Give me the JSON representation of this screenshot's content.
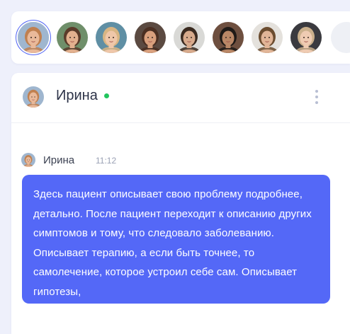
{
  "contacts": [
    {
      "id": "c1",
      "active": true,
      "icon": "avatar-icon",
      "hair": "#c08050",
      "skin": "#e9b99a",
      "bg": "#9fb6cf"
    },
    {
      "id": "c2",
      "active": false,
      "icon": "avatar-icon",
      "hair": "#5a3b2a",
      "skin": "#e2b08e",
      "bg": "#6f8f6a"
    },
    {
      "id": "c3",
      "active": false,
      "icon": "avatar-icon",
      "hair": "#d8b583",
      "skin": "#efc7a9",
      "bg": "#5f8fa4"
    },
    {
      "id": "c4",
      "active": false,
      "icon": "avatar-icon",
      "hair": "#4b2f22",
      "skin": "#d9a07d",
      "bg": "#5b4a41"
    },
    {
      "id": "c5",
      "active": false,
      "icon": "avatar-icon",
      "hair": "#3a2a20",
      "skin": "#d7aa8c",
      "bg": "#d9d9d6"
    },
    {
      "id": "c6",
      "active": false,
      "icon": "avatar-icon",
      "hair": "#1f1a17",
      "skin": "#b98766",
      "bg": "#6e4f3f"
    },
    {
      "id": "c7",
      "active": false,
      "icon": "avatar-icon",
      "hair": "#6b4c2f",
      "skin": "#e1b597",
      "bg": "#e4e1dc"
    },
    {
      "id": "c8",
      "active": false,
      "icon": "avatar-icon",
      "hair": "#cbb08c",
      "skin": "#efcbb2",
      "bg": "#3a3a3f"
    }
  ],
  "chat": {
    "name": "Ирина",
    "online": true,
    "menu_icon": "more-vertical-icon"
  },
  "message": {
    "author": "Ирина",
    "time": "11:12",
    "text": "Здесь пациент описывает свою проблему подробнее, детально. После пациент переходит к описанию других симптомов и тому, что следовало заболеванию. Описывает терапию, а если быть точнее, то самолечение, которое устроил себе сам. Описывает гипотезы,"
  },
  "colors": {
    "accent": "#5468f7",
    "online": "#22c55e",
    "background": "#eef0fb"
  }
}
